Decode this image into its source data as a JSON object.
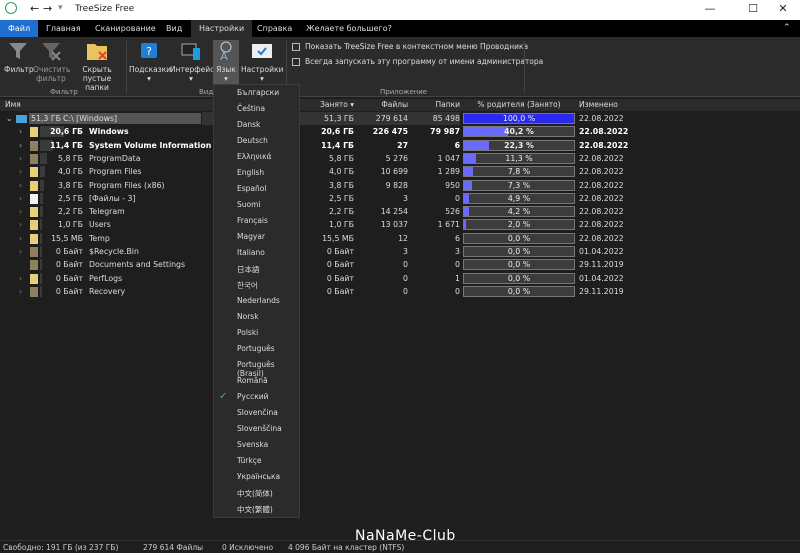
{
  "titlebar": {
    "title": "TreeSize Free",
    "minimize": "—",
    "maximize": "☐",
    "close": "✕"
  },
  "tabs": [
    "Файл",
    "Главная",
    "Сканирование",
    "Вид",
    "Настройки",
    "Справка",
    "Желаете большего?"
  ],
  "ribbon": {
    "filter": "Фильтр",
    "clear_filter": "Очистить фильтр",
    "hide_empty": "Скрыть пустые папки",
    "group_filter": "Фильтр",
    "hints": "Подсказки",
    "interface": "Интерфейс",
    "language": "Язык",
    "settings": "Настройки",
    "group_view": "Вид",
    "check1": "Показать TreeSize Free в контекстном меню Проводника",
    "check2": "Всегда запускать эту программу от имени администратора",
    "group_app": "Приложение"
  },
  "columns": {
    "name": "Имя",
    "size": "Занято ▾",
    "files": "Файлы",
    "folders": "Папки",
    "percent": "% родителя (Занято)",
    "modified": "Изменено"
  },
  "rows": [
    {
      "size": "51,3 ГБ",
      "name": "C:\\   [Windows]",
      "files": "279 614",
      "folders": "85 498",
      "pct": 100.0,
      "pct_label": "100,0 %",
      "date": "22.08.2022",
      "bold": false,
      "root": true
    },
    {
      "size": "20,6 ГБ",
      "name": "Windows",
      "files": "226 475",
      "folders": "79 987",
      "pct": 40.2,
      "pct_label": "40,2 %",
      "date": "22.08.2022",
      "bold": true
    },
    {
      "size": "11,4 ГБ",
      "name": "System Volume Information",
      "files": "27",
      "folders": "6",
      "pct": 22.3,
      "pct_label": "22,3 %",
      "date": "22.08.2022",
      "bold": true
    },
    {
      "size": "5,8 ГБ",
      "name": "ProgramData",
      "files": "5 276",
      "folders": "1 047",
      "pct": 11.3,
      "pct_label": "11,3 %",
      "date": "22.08.2022"
    },
    {
      "size": "4,0 ГБ",
      "name": "Program Files",
      "files": "10 699",
      "folders": "1 289",
      "pct": 7.8,
      "pct_label": "7,8 %",
      "date": "22.08.2022"
    },
    {
      "size": "3,8 ГБ",
      "name": "Program Files (x86)",
      "files": "9 828",
      "folders": "950",
      "pct": 7.3,
      "pct_label": "7,3 %",
      "date": "22.08.2022"
    },
    {
      "size": "2,5 ГБ",
      "name": "[Файлы - 3]",
      "files": "3",
      "folders": "0",
      "pct": 4.9,
      "pct_label": "4,9 %",
      "date": "22.08.2022",
      "file": true
    },
    {
      "size": "2,2 ГБ",
      "name": "Telegram",
      "files": "14 254",
      "folders": "526",
      "pct": 4.2,
      "pct_label": "4,2 %",
      "date": "22.08.2022"
    },
    {
      "size": "1,0 ГБ",
      "name": "Users",
      "files": "13 037",
      "folders": "1 671",
      "pct": 2.0,
      "pct_label": "2,0 %",
      "date": "22.08.2022"
    },
    {
      "size": "15,5 МБ",
      "name": "Temp",
      "files": "12",
      "folders": "6",
      "pct": 0,
      "pct_label": "0,0 %",
      "date": "22.08.2022"
    },
    {
      "size": "0 Байт",
      "name": "$Recycle.Bin",
      "files": "3",
      "folders": "3",
      "pct": 0,
      "pct_label": "0,0 %",
      "date": "01.04.2022"
    },
    {
      "size": "0 Байт",
      "name": "Documents and Settings",
      "files": "0",
      "folders": "0",
      "pct": 0,
      "pct_label": "0,0 %",
      "date": "29.11.2019"
    },
    {
      "size": "0 Байт",
      "name": "PerfLogs",
      "files": "0",
      "folders": "1",
      "pct": 0,
      "pct_label": "0,0 %",
      "date": "01.04.2022"
    },
    {
      "size": "0 Байт",
      "name": "Recovery",
      "files": "0",
      "folders": "0",
      "pct": 0,
      "pct_label": "0,0 %",
      "date": "29.11.2019"
    }
  ],
  "languages": [
    "Български",
    "Čeština",
    "Dansk",
    "Deutsch",
    "Ελληνικά",
    "English",
    "Español",
    "Suomi",
    "Français",
    "Magyar",
    "Italiano",
    "日本語",
    "한국어",
    "Nederlands",
    "Norsk",
    "Polski",
    "Português",
    "Português (Brasil)",
    "Română",
    "Русский",
    "Slovenčina",
    "Slovenščina",
    "Svenska",
    "Türkçe",
    "Українська",
    "中文(简体)",
    "中文(繁體)"
  ],
  "selected_language": "Русский",
  "status": {
    "free": "Свободно: 191 ГБ  (из 237 ГБ)",
    "files": "279 614 Файлы",
    "excluded": "0 Исключено",
    "cluster": "4 096 Байт на кластер (NTFS)"
  },
  "watermark": "NaNaMe-Club",
  "colors": {
    "accent": "#1e6fd0",
    "bar": "#6a6aff",
    "root_bar": "#2a2aee"
  }
}
